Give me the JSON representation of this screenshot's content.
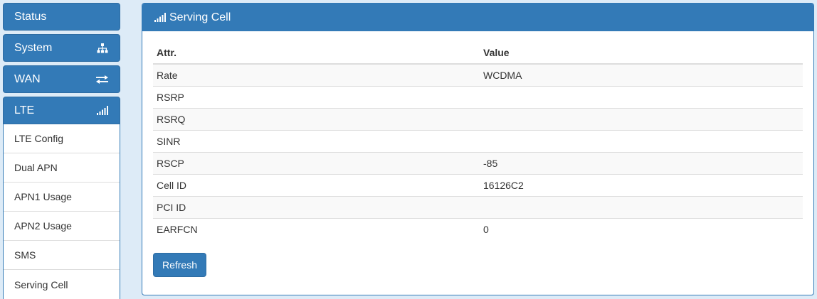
{
  "sidebar": {
    "status": {
      "label": "Status"
    },
    "system": {
      "label": "System",
      "icon": "sitemap-icon"
    },
    "wan": {
      "label": "WAN",
      "icon": "exchange-arrows-icon"
    },
    "lte": {
      "label": "LTE",
      "icon": "signal-bars-icon",
      "items": [
        {
          "label": "LTE Config"
        },
        {
          "label": "Dual APN"
        },
        {
          "label": "APN1 Usage"
        },
        {
          "label": "APN2 Usage"
        },
        {
          "label": "SMS"
        },
        {
          "label": "Serving Cell"
        }
      ]
    }
  },
  "panel": {
    "title": "Serving Cell",
    "icon": "signal-bars-icon",
    "table": {
      "headers": [
        "Attr.",
        "Value"
      ],
      "rows": [
        {
          "attr": "Rate",
          "value": "WCDMA"
        },
        {
          "attr": "RSRP",
          "value": ""
        },
        {
          "attr": "RSRQ",
          "value": ""
        },
        {
          "attr": "SINR",
          "value": ""
        },
        {
          "attr": "RSCP",
          "value": "-85"
        },
        {
          "attr": "Cell ID",
          "value": "16126C2"
        },
        {
          "attr": "PCI ID",
          "value": ""
        },
        {
          "attr": "EARFCN",
          "value": "0"
        }
      ]
    },
    "refresh_label": "Refresh"
  },
  "colors": {
    "primary": "#337ab7",
    "background": "#ddebf7"
  }
}
